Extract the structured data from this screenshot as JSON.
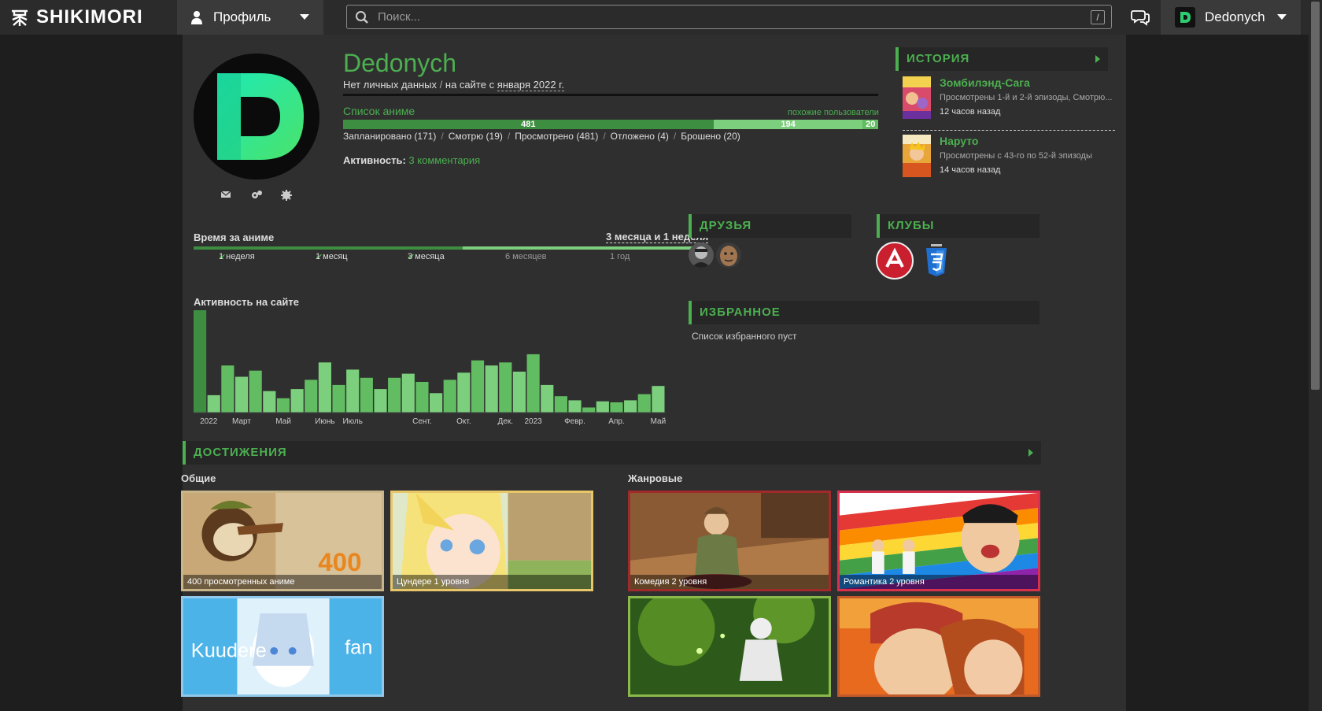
{
  "header": {
    "logo_text": "SHIKIMORI",
    "profile_menu_label": "Профиль",
    "search_placeholder": "Поиск...",
    "search_shortcut": "/",
    "user_name": "Dedonych"
  },
  "profile": {
    "username": "Dedonych",
    "no_data": "Нет личных данных",
    "separator": "/",
    "on_site_prefix": "на сайте с",
    "on_site_since": "января 2022 г.",
    "anime_list_title": "Список аниме",
    "similar_users": "похожие пользователи",
    "bar": {
      "completed": 481,
      "planned": 194,
      "other": 20
    },
    "stats": [
      "Запланировано (171)",
      "Смотрю (19)",
      "Просмотрено (481)",
      "Отложено (4)",
      "Брошено (20)"
    ],
    "activity_label": "Активность:",
    "activity_link": "3 комментария"
  },
  "time_spent": {
    "title": "Время за аниме",
    "value": "3 месяца и 1 неделя",
    "ticks": [
      {
        "label": "1 неделя",
        "reached": true
      },
      {
        "label": "1 месяц",
        "reached": true
      },
      {
        "label": "3 месяца",
        "reached": true
      },
      {
        "label": "6 месяцев",
        "reached": false
      },
      {
        "label": "1 год",
        "reached": false
      }
    ]
  },
  "activity": {
    "title": "Активность на сайте"
  },
  "chart_data": {
    "type": "bar",
    "title": "Активность на сайте",
    "xlabel": "",
    "ylabel": "",
    "x_tick_labels": [
      "2022",
      "Март",
      "Май",
      "Июнь",
      "Июль",
      "Сент.",
      "Окт.",
      "Дек.",
      "2023",
      "Февр.",
      "Апр.",
      "Май"
    ],
    "values": [
      100,
      17,
      46,
      35,
      41,
      21,
      14,
      23,
      32,
      49,
      27,
      42,
      34,
      23,
      34,
      38,
      30,
      19,
      32,
      39,
      51,
      46,
      49,
      40,
      57,
      27,
      16,
      12,
      5,
      11,
      10,
      12,
      18,
      26
    ],
    "ylim": [
      0,
      100
    ],
    "grid": false,
    "colors": [
      "#3e8e41",
      "#7ccf7c",
      "#62bd62"
    ]
  },
  "history": {
    "title": "ИСТОРИЯ",
    "items": [
      {
        "title": "Зомбилэнд-Сага",
        "desc": "Просмотрены 1-й и 2-й эпизоды, Смотрю...",
        "time": "12 часов назад"
      },
      {
        "title": "Наруто",
        "desc": "Просмотрены с 43-го по 52-й эпизоды",
        "time": "14 часов назад"
      }
    ]
  },
  "friends": {
    "title": "ДРУЗЬЯ"
  },
  "clubs": {
    "title": "КЛУБЫ"
  },
  "favourites": {
    "title": "ИЗБРАННОЕ",
    "empty": "Список избранного пуст"
  },
  "achievements": {
    "title": "ДОСТИЖЕНИЯ",
    "general_title": "Общие",
    "genre_title": "Жанровые",
    "general": [
      {
        "caption": "400 просмотренных аниме"
      },
      {
        "caption": "Цундере 1 уровня"
      },
      {
        "caption": ""
      }
    ],
    "genre": [
      {
        "caption": "Комедия 2 уровня"
      },
      {
        "caption": "Романтика 2 уровня"
      },
      {
        "caption": ""
      },
      {
        "caption": ""
      }
    ],
    "art_text": {
      "big_number": "400",
      "kuudere_left": "Kuudere",
      "kuudere_right": "fan"
    }
  },
  "colors": {
    "accent": "#4caf50",
    "bar_dark": "#3e8e41",
    "bar_light": "#7ccf7c"
  }
}
